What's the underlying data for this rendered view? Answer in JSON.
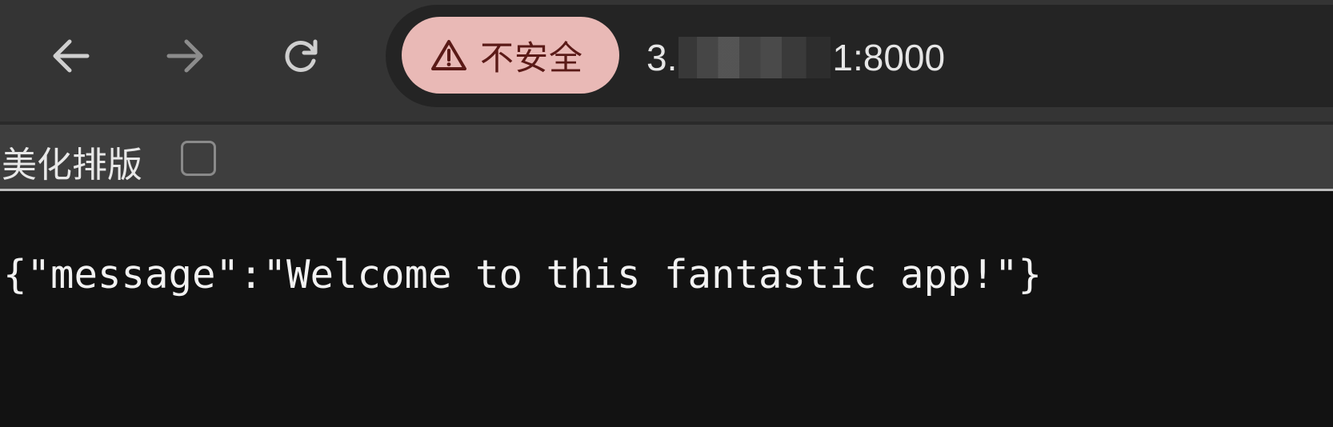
{
  "toolbar": {
    "security_label": "不安全",
    "url_prefix": "3.",
    "url_suffix": "1:8000",
    "security_chip_color": "#e9b9b6"
  },
  "pretty_print": {
    "label": "美化排版",
    "checked": false
  },
  "page": {
    "json_text": "{\"message\":\"Welcome to this fantastic app!\"}"
  },
  "icons": {
    "back": "arrow-left-icon",
    "forward": "arrow-right-icon",
    "reload": "reload-icon",
    "warning": "warning-triangle-icon"
  }
}
